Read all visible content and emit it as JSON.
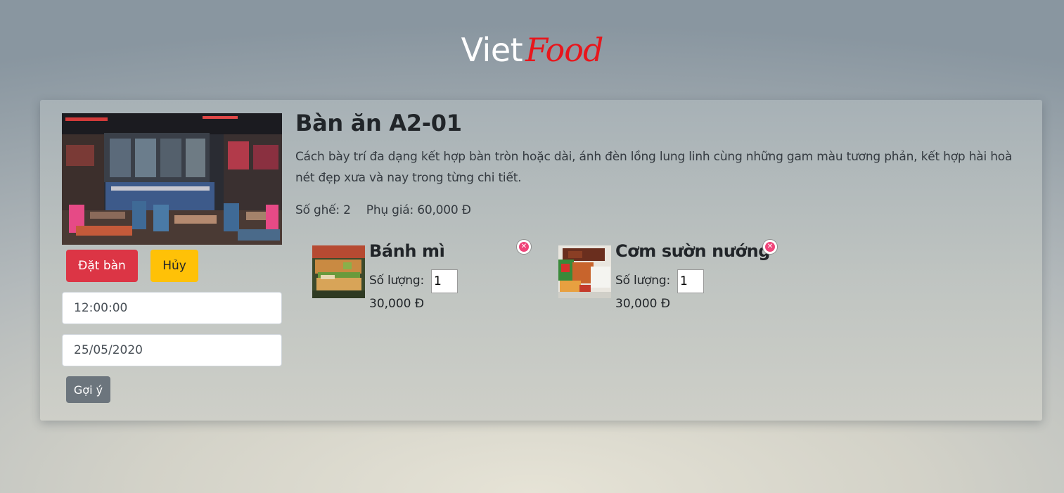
{
  "brand": {
    "part1": "Viet",
    "part2": "Food",
    "part1_color": "#ffffff",
    "part2_color": "#e8161c"
  },
  "table": {
    "title": "Bàn ăn A2-01",
    "description": "Cách bày trí đa dạng kết hợp bàn tròn hoặc dài, ánh đèn lồng lung linh cùng những gam màu tương phản, kết hợp hài hoà nét đẹp xưa và nay trong từng chi tiết.",
    "seats_label": "Số ghế: 2",
    "surcharge_label": "Phụ giá: 60,000 Đ"
  },
  "actions": {
    "book_label": "Đặt bàn",
    "cancel_label": "Hủy",
    "suggest_label": "Gợi ý",
    "book_color": "#dc3545",
    "cancel_color": "#ffc107",
    "suggest_color": "#6c757d"
  },
  "booking": {
    "time_value": "12:00:00",
    "date_value": "25/05/2020"
  },
  "dishes": [
    {
      "name": "Bánh mì",
      "qty_label": "Số lượng:",
      "qty_value": "1",
      "price": "30,000 Đ",
      "image_icon": "banh-mi-photo",
      "remove_icon": "close-circle-icon"
    },
    {
      "name": "Cơm sườn nướng",
      "qty_label": "Số lượng:",
      "qty_value": "1",
      "price": "30,000 Đ",
      "image_icon": "com-suon-photo",
      "remove_icon": "close-circle-icon"
    }
  ]
}
